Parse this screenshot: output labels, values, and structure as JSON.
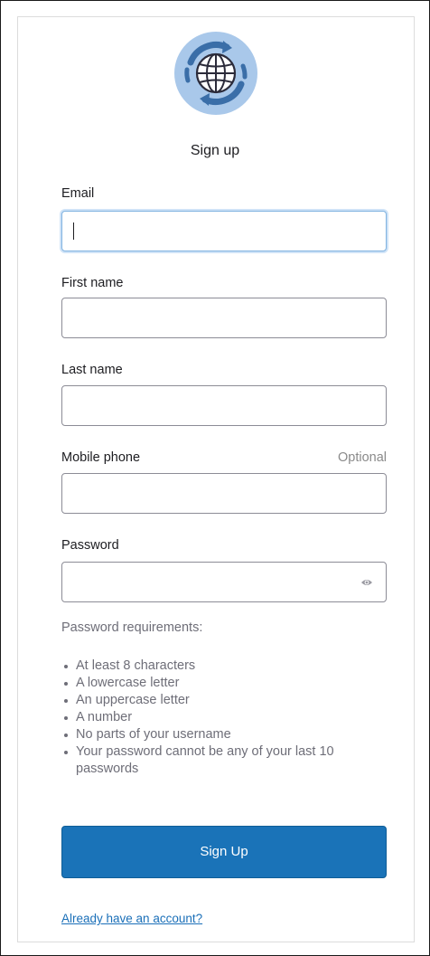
{
  "header": {
    "title": "Sign up",
    "logo_icon": "globe-refresh-logo"
  },
  "form": {
    "email": {
      "label": "Email",
      "value": "",
      "placeholder": ""
    },
    "first_name": {
      "label": "First name",
      "value": "",
      "placeholder": ""
    },
    "last_name": {
      "label": "Last name",
      "value": "",
      "placeholder": ""
    },
    "mobile_phone": {
      "label": "Mobile phone",
      "optional_label": "Optional",
      "value": "",
      "placeholder": ""
    },
    "password": {
      "label": "Password",
      "value": "",
      "placeholder": "",
      "toggle_icon": "eye-icon"
    }
  },
  "requirements": {
    "title": "Password requirements:",
    "items": [
      "At least 8 characters",
      "A lowercase letter",
      "An uppercase letter",
      "A number",
      "No parts of your username",
      "Your password cannot be any of your last 10 passwords"
    ]
  },
  "actions": {
    "submit_label": "Sign Up",
    "signin_link": "Already have an account?"
  },
  "colors": {
    "primary": "#1a73b8",
    "link": "#1a6fb8",
    "focus_border": "#7fb2e0",
    "muted_text": "#6e6e78"
  }
}
